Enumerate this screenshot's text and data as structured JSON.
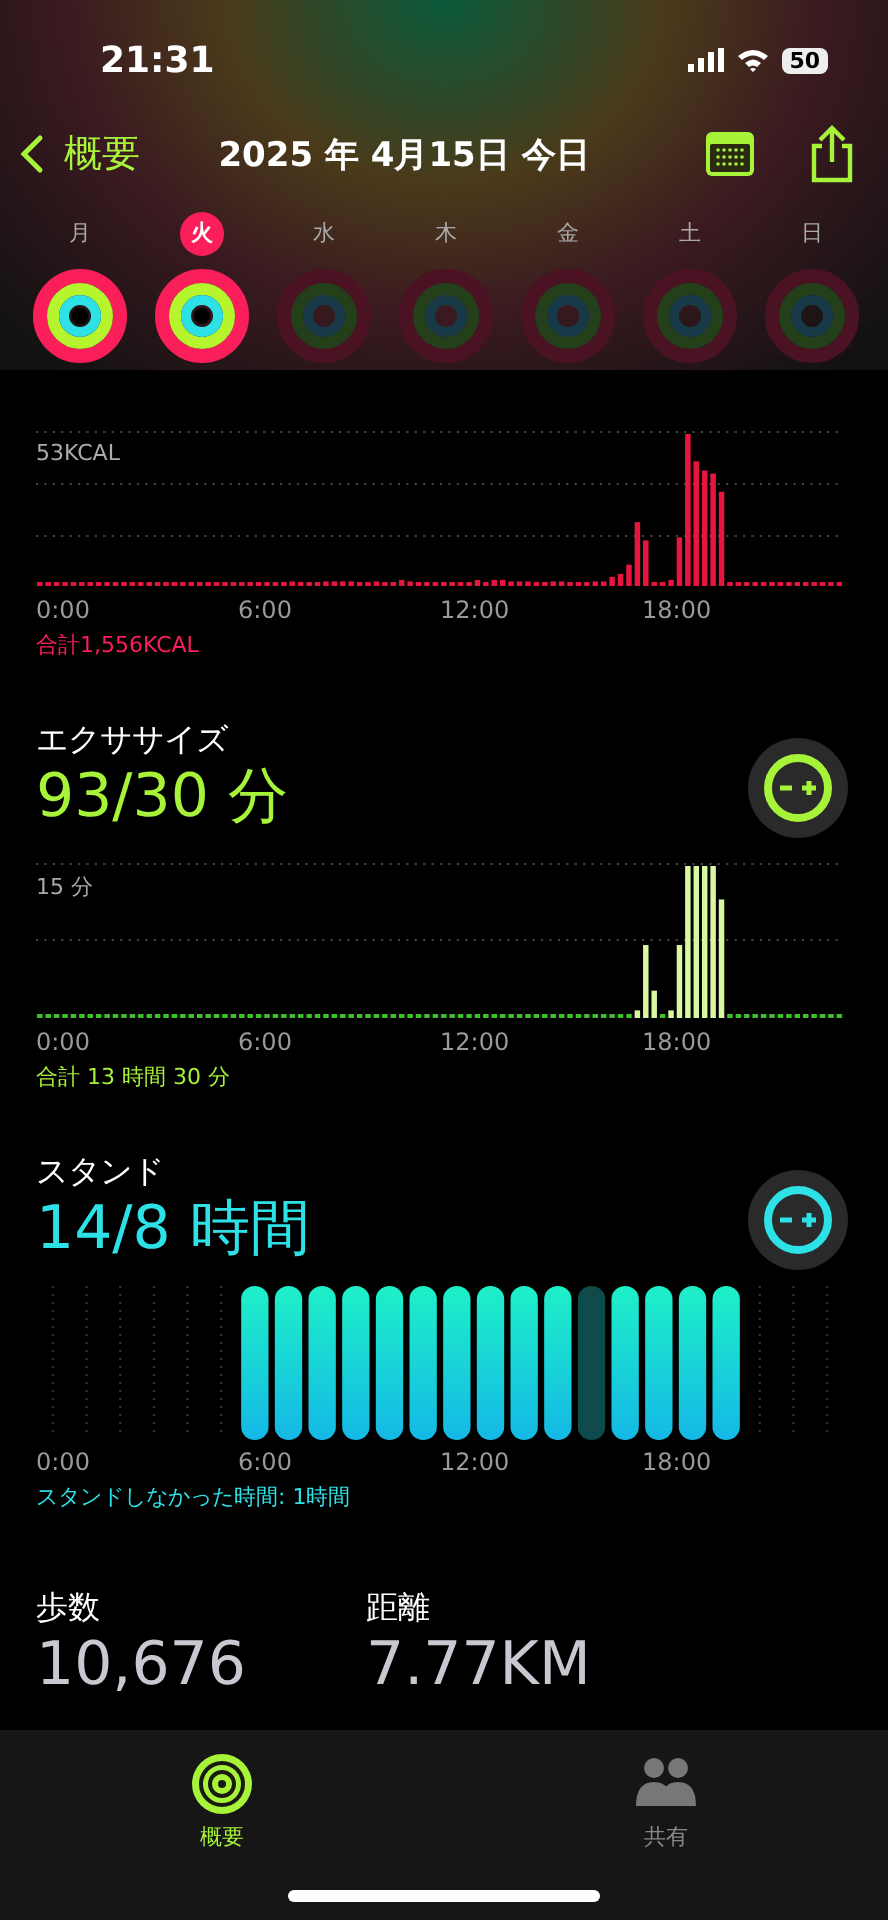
{
  "status_bar": {
    "time": "21:31",
    "battery": "50"
  },
  "nav": {
    "back_label": "概要",
    "title": "2025 年 4月15日 今日"
  },
  "week": [
    {
      "day": "月",
      "selected": false,
      "closed_rings": true
    },
    {
      "day": "火",
      "selected": true,
      "closed_rings": true
    },
    {
      "day": "水",
      "selected": false,
      "closed_rings": false
    },
    {
      "day": "木",
      "selected": false,
      "closed_rings": false
    },
    {
      "day": "金",
      "selected": false,
      "closed_rings": false
    },
    {
      "day": "土",
      "selected": false,
      "closed_rings": false
    },
    {
      "day": "日",
      "selected": false,
      "closed_rings": false
    }
  ],
  "sections": [
    {
      "kind": "move",
      "max_label": "53KCAL",
      "x_labels": [
        "0:00",
        "6:00",
        "12:00",
        "18:00"
      ],
      "footer": "合計1,556KCAL"
    },
    {
      "kind": "exercise",
      "title": "エクササイズ",
      "value": "93/30 分",
      "max_label": "15 分",
      "x_labels": [
        "0:00",
        "6:00",
        "12:00",
        "18:00"
      ],
      "footer": "合計 13 時間 30 分"
    },
    {
      "kind": "stand",
      "title": "スタンド",
      "value": "14/8 時間",
      "x_labels": [
        "0:00",
        "6:00",
        "12:00",
        "18:00"
      ],
      "footer": "スタンドしなかった時間: 1時間"
    }
  ],
  "stats": [
    {
      "label": "歩数",
      "value": "10,676"
    },
    {
      "label": "距離",
      "value": "7.77KM"
    }
  ],
  "tab_bar": [
    {
      "label": "概要",
      "selected": true
    },
    {
      "label": "共有",
      "selected": false
    }
  ]
}
